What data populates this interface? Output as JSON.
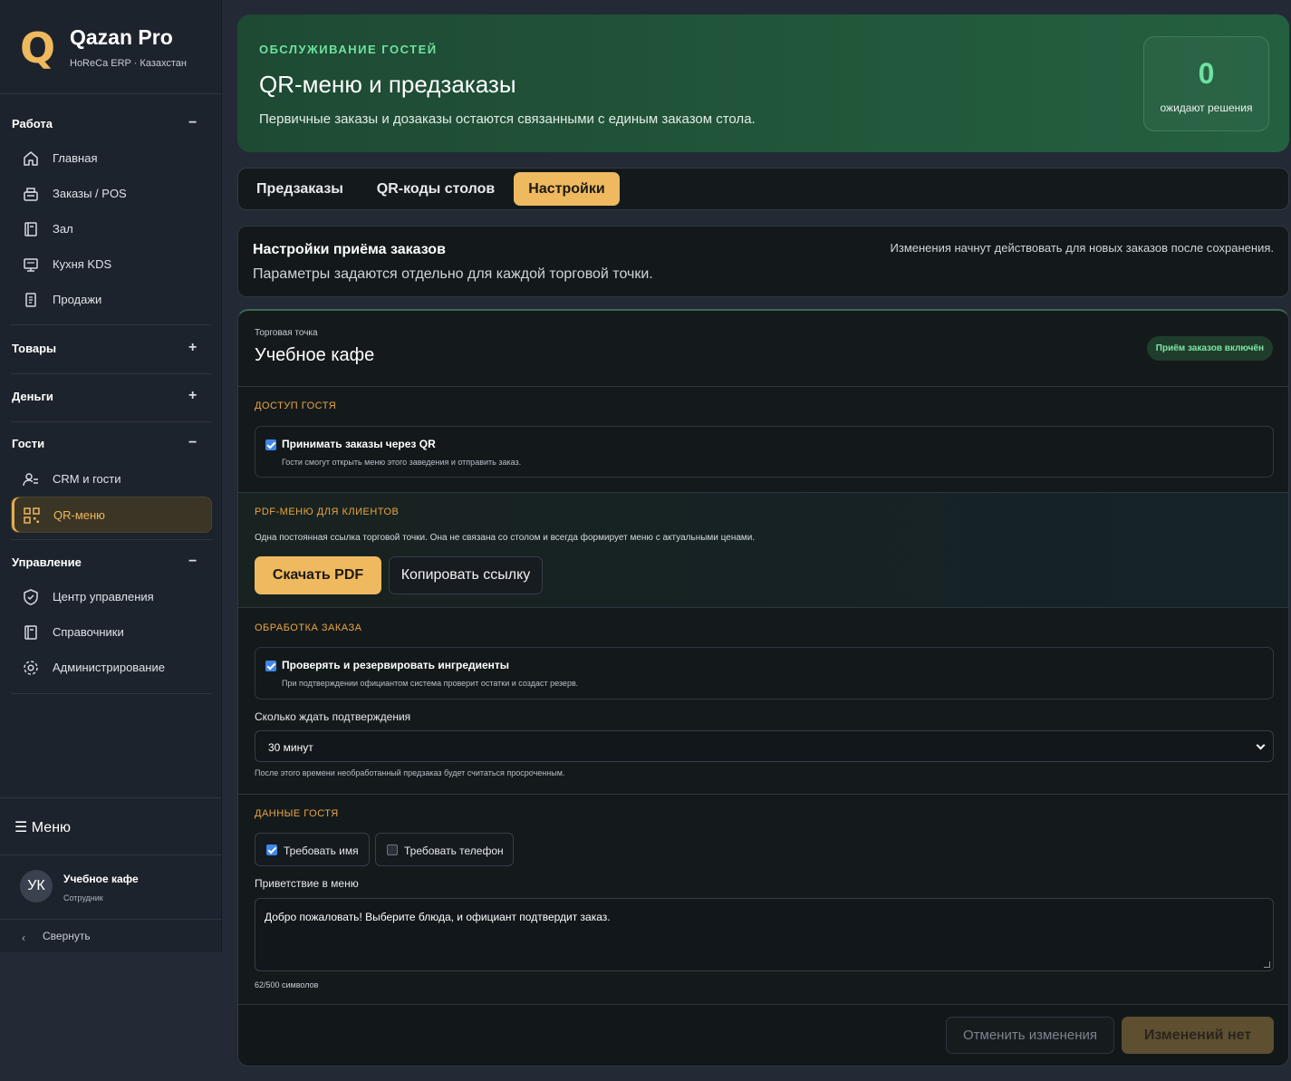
{
  "brand": {
    "logo_letter": "Q",
    "title": "Qazan Pro",
    "subtitle": "HoReCa ERP · Казахстан"
  },
  "sidebar": {
    "sections": [
      {
        "label": "Работа",
        "toggle": "−",
        "items": [
          {
            "label": "Главная",
            "icon": "home-icon"
          },
          {
            "label": "Заказы / POS",
            "icon": "register-icon"
          },
          {
            "label": "Зал",
            "icon": "book-icon"
          },
          {
            "label": "Кухня KDS",
            "icon": "monitor-icon"
          },
          {
            "label": "Продажи",
            "icon": "receipt-icon"
          }
        ]
      },
      {
        "label": "Товары",
        "toggle": "+"
      },
      {
        "label": "Деньги",
        "toggle": "+"
      },
      {
        "label": "Гости",
        "toggle": "−",
        "items": [
          {
            "label": "CRM и гости",
            "icon": "users-icon"
          },
          {
            "label": "QR-меню",
            "icon": "qr-icon",
            "active": true
          }
        ]
      },
      {
        "label": "Управление",
        "toggle": "−",
        "items": [
          {
            "label": "Центр управления",
            "icon": "shield-icon"
          },
          {
            "label": "Справочники",
            "icon": "book-icon"
          },
          {
            "label": "Администрирование",
            "icon": "gear-icon"
          }
        ]
      }
    ],
    "menu_button": "☰ Меню",
    "user": {
      "initials": "УК",
      "name": "Учебное кафе",
      "role": "Сотрудник"
    },
    "collapse": {
      "chevron": "‹",
      "label": "Свернуть"
    }
  },
  "hero": {
    "kicker": "ОБСЛУЖИВАНИЕ ГОСТЕЙ",
    "title": "QR-меню и предзаказы",
    "description": "Первичные заказы и дозаказы остаются связанными с единым заказом стола.",
    "stat_value": "0",
    "stat_caption": "ожидают решения"
  },
  "tabs": [
    {
      "label": "Предзаказы",
      "active": false
    },
    {
      "label": "QR-коды столов",
      "active": false
    },
    {
      "label": "Настройки",
      "active": true
    }
  ],
  "settings_header": {
    "title": "Настройки приёма заказов",
    "subtitle": "Параметры задаются отдельно для каждой торговой точки.",
    "note": "Изменения начнут действовать для новых заказов после сохранения."
  },
  "panel": {
    "location_label": "Торговая точка",
    "location_name": "Учебное кафе",
    "status_badge": "Приём заказов включён",
    "guest_access": {
      "title": "ДОСТУП ГОСТЯ",
      "option_label": "Принимать заказы через QR",
      "option_checked": true,
      "option_hint": "Гости смогут открыть меню этого заведения и отправить заказ."
    },
    "pdf_menu": {
      "title": "PDF-МЕНЮ ДЛЯ КЛИЕНТОВ",
      "description": "Одна постоянная ссылка торговой точки. Она не связана со столом и всегда формирует меню с актуальными ценами.",
      "download_label": "Скачать PDF",
      "copy_label": "Копировать ссылку"
    },
    "order_processing": {
      "title": "ОБРАБОТКА ЗАКАЗА",
      "option_label": "Проверять и резервировать ингредиенты",
      "option_checked": true,
      "option_hint": "При подтверждении официантом система проверит остатки и создаст резерв.",
      "wait_label": "Сколько ждать подтверждения",
      "wait_value": "30 минут",
      "wait_hint": "После этого времени необработанный предзаказ будет считаться просроченным."
    },
    "guest_data": {
      "title": "ДАННЫЕ ГОСТЯ",
      "require_name_label": "Требовать имя",
      "require_name_checked": true,
      "require_phone_label": "Требовать телефон",
      "require_phone_checked": false,
      "greeting_label": "Приветствие в меню",
      "greeting_value": "Добро пожаловать! Выберите блюда, и официант подтвердит заказ.",
      "counter": "62/500 символов"
    },
    "footer": {
      "cancel_label": "Отменить изменения",
      "save_label": "Изменений нет"
    }
  },
  "colors": {
    "accent": "#efb960",
    "success": "#6ee2a0",
    "section_title": "#e9a443"
  }
}
